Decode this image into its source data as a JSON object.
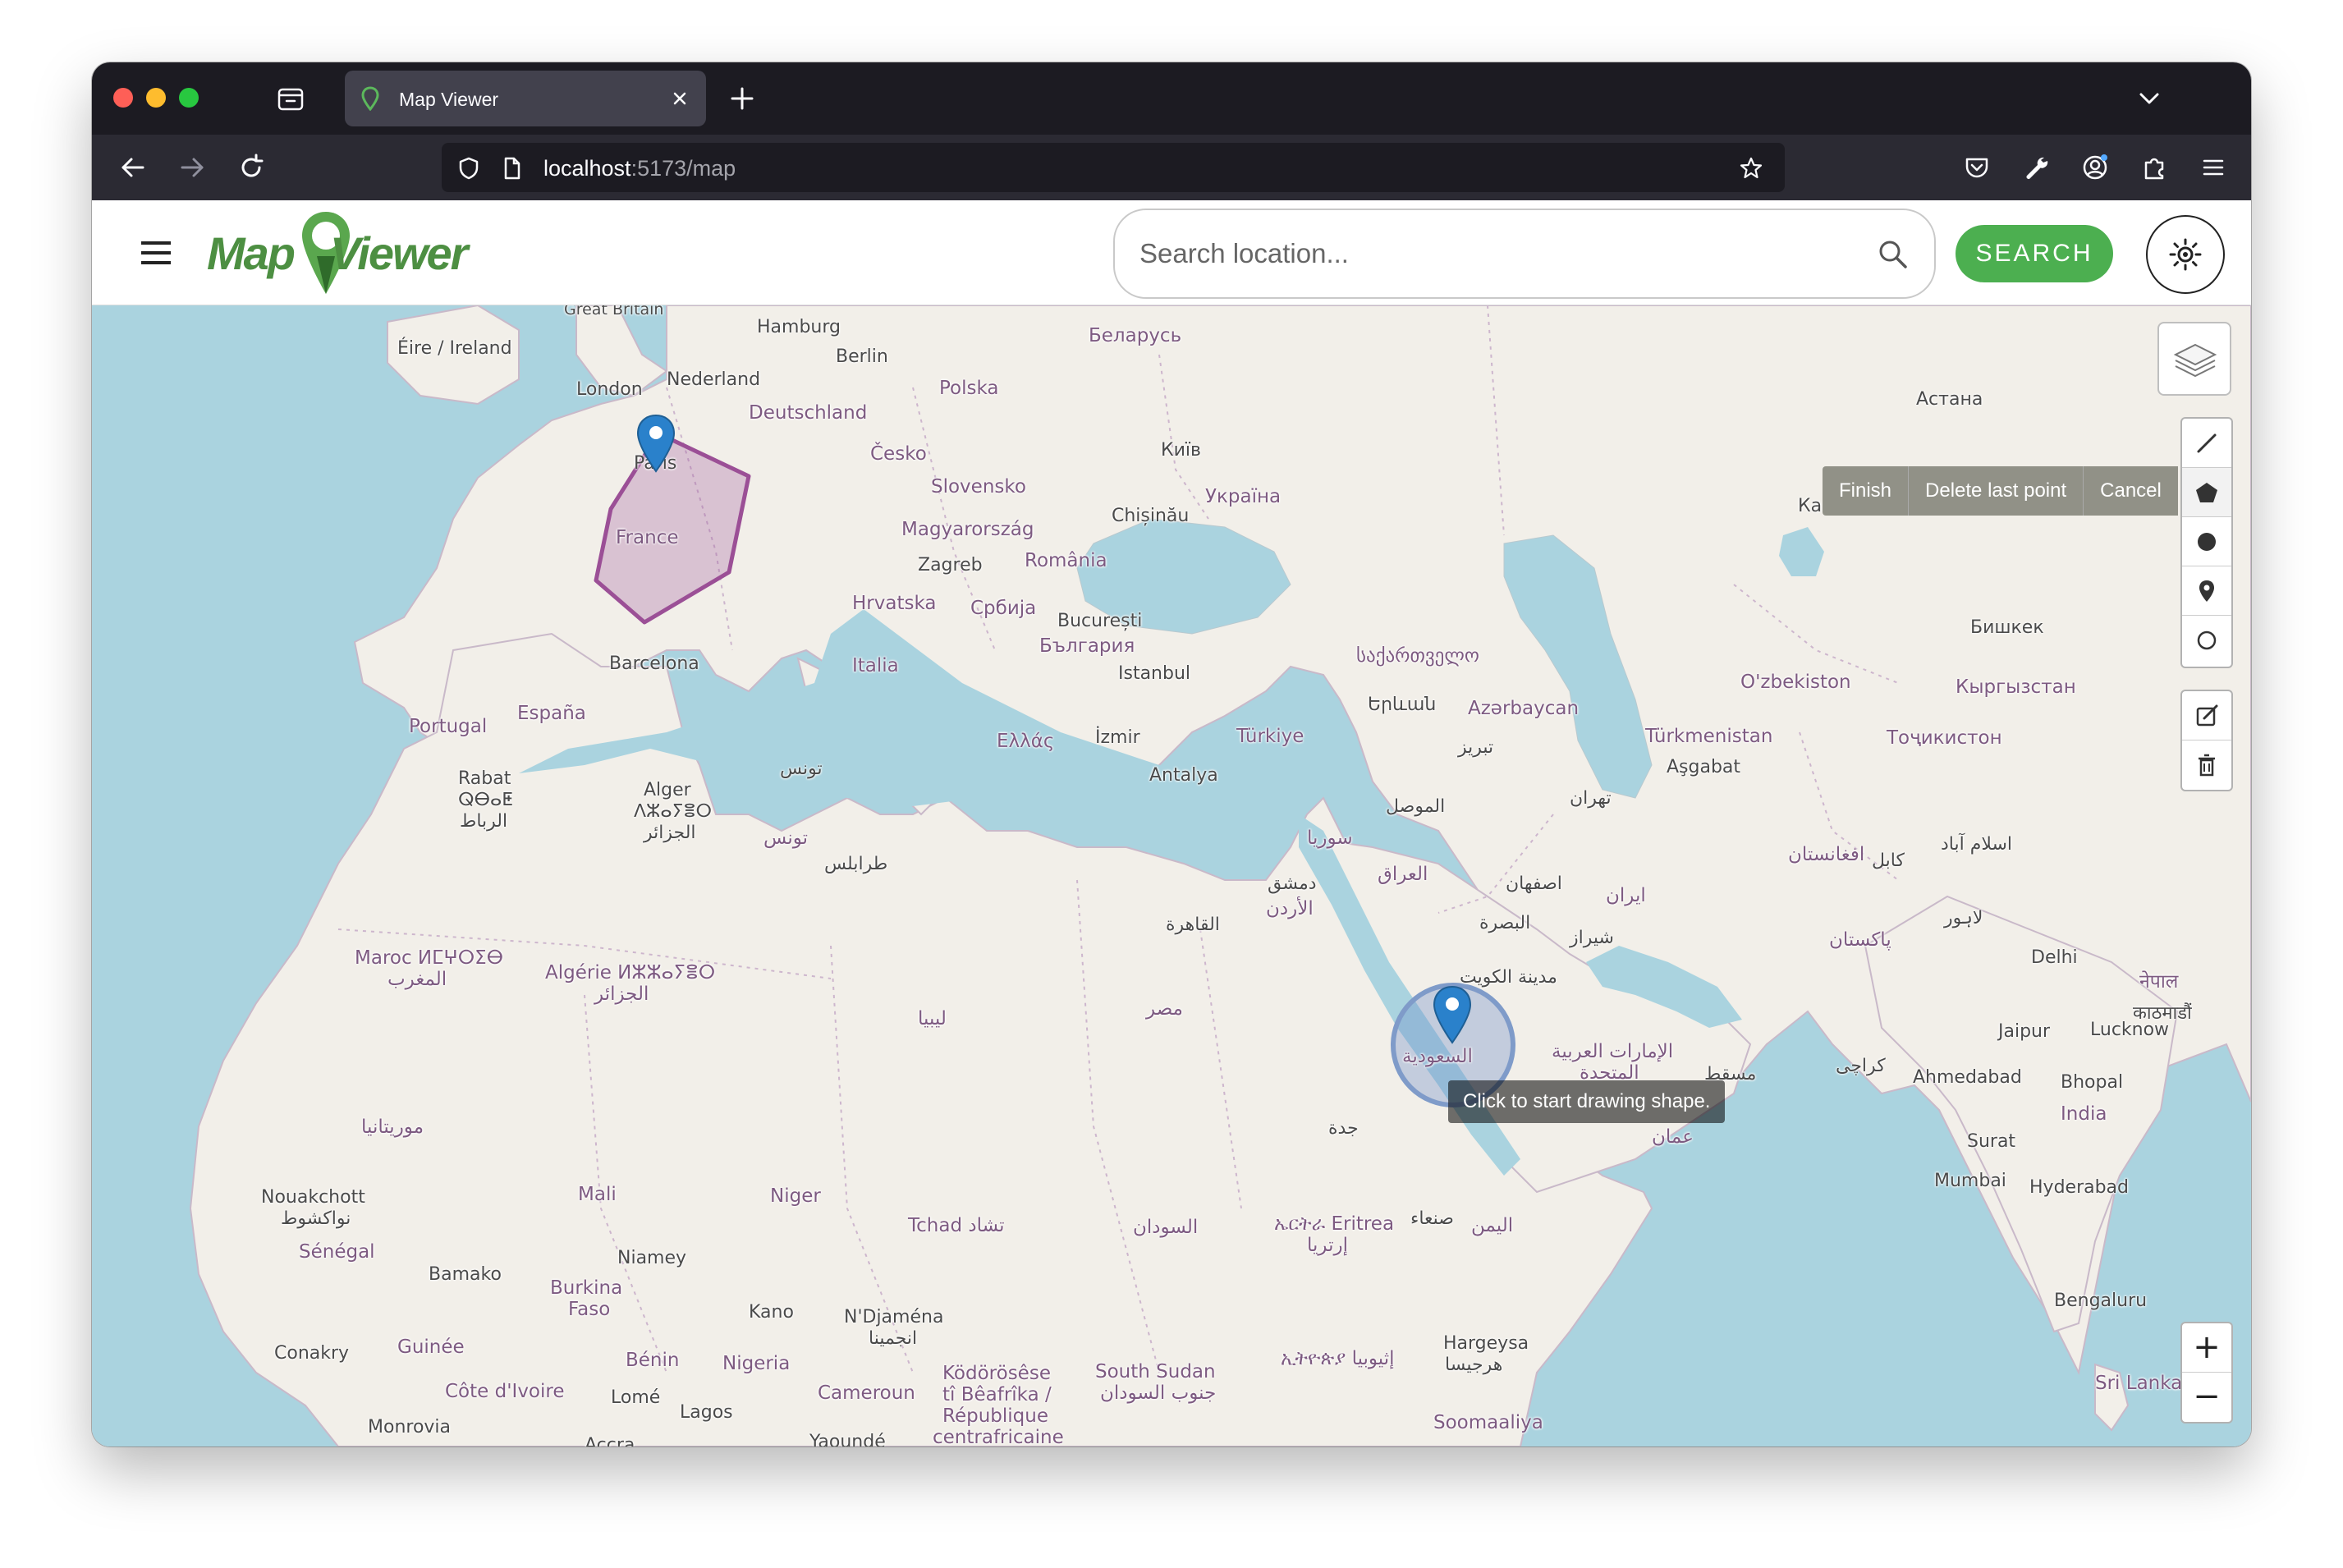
{
  "browser": {
    "tab_title": "Map Viewer",
    "url_host": "localhost",
    "url_path": ":5173/map"
  },
  "header": {
    "logo_left": "Map",
    "logo_right": "Viewer",
    "search_placeholder": "Search location...",
    "search_button": "SEARCH"
  },
  "map": {
    "draw_actions": [
      "Finish",
      "Delete last point",
      "Cancel"
    ],
    "tooltip": "Click to start drawing shape.",
    "zoom_in": "+",
    "zoom_out": "−",
    "labels": {
      "great_britain": "Great Britain",
      "eire": "Éire / Ireland",
      "london": "London",
      "nederland": "Nederland",
      "hamburg": "Hamburg",
      "berlin": "Berlin",
      "deutschland": "Deutschland",
      "polska": "Polska",
      "belarus": "Беларусь",
      "astana": "Астана",
      "paris": "Paris",
      "france": "France",
      "cesko": "Česko",
      "kyiv": "Київ",
      "slovensko": "Slovensko",
      "ukraina": "Україна",
      "magyarorszag": "Magyarország",
      "chisinau": "Chișinău",
      "zagreb": "Zagreb",
      "romania": "România",
      "hrvatska": "Hrvatska",
      "srbija": "Србија",
      "bucuresti": "București",
      "bulgaria": "България",
      "barcelona": "Barcelona",
      "italia": "Italia",
      "istanbul": "Istanbul",
      "sakartvelo": "საქართველო",
      "bishkek": "Бишкек",
      "uzbekiston": "O'zbekiston",
      "kyrgyzstan": "Кыргызстан",
      "portugal": "Portugal",
      "espana": "España",
      "yerevan": "Երևան",
      "azerbaycan": "Azərbaycan",
      "ellas": "Ελλάς",
      "izmir": "İzmir",
      "turkiye": "Türkiye",
      "turkmenistan": "Türkmenistan",
      "tojikiston": "Тоҷикистон",
      "tabriz": "تبریز",
      "ashgabat": "Aşgabat",
      "antalya": "Antalya",
      "rabat": "Rabat",
      "rabat_tif": "ⵕⴱⴰⵟ",
      "rabat_ar": "الرباط",
      "alger": "Alger",
      "alger_tif": "ⴷⵣⴰⵢⴻⵔ",
      "alger_ar": "الجزائر",
      "tunis": "تونس",
      "tunis2": "تونس",
      "tehran": "تهران",
      "mosul": "الموصل",
      "syria": "سوريا",
      "iraq": "العراق",
      "isfahan": "اصفهان",
      "iran": "ایران",
      "afghanistan": "افغانستان",
      "kabul": "کابل",
      "islamabad": "اسلام آباد",
      "tripoli": "طرابلس",
      "damascus": "دمشق",
      "jordan": "الأردن",
      "basra": "البصرة",
      "shiraz": "شيراز",
      "pakistan": "پاکستان",
      "lahore": "لاہور",
      "cairo": "القاهرة",
      "kuwait": "مدينة الكويت",
      "delhi": "Delhi",
      "nepal": "नेपाल",
      "kathmandu": "काठमाडौं",
      "maroc": "Maroc ⵍⵎⵖⵔⵉⴱ",
      "maroc_ar": "المغرب",
      "algerie": "Algérie ⵍⵣⵣⴰⵢⴻⵔ",
      "algerie_ar": "الجزائر",
      "libya": "ليبيا",
      "egypt": "مصر",
      "saudi": "السعودية",
      "uae": "الإمارات العربية",
      "uae2": "المتحدة",
      "muscat": "مسقط",
      "jaipur": "Jaipur",
      "lucknow": "Lucknow",
      "karachi": "کراچی",
      "ahmedabad": "Ahmedabad",
      "bhopal": "Bhopal",
      "india": "India",
      "oman": "عمان",
      "mauritania": "موريتانيا",
      "jeddah": "جدة",
      "surat": "Surat",
      "nouakchott": "Nouakchott",
      "nouakchott_ar": "نواكشوط",
      "mali": "Mali",
      "niger": "Niger",
      "mumbai": "Mumbai",
      "hyderabad": "Hyderabad",
      "senegal": "Sénégal",
      "tchad": "Tchad تشاد",
      "sudan": "السودان",
      "eritrea": "ኤርትራ Eritrea",
      "eritrea_ar": "إرتريا",
      "sanaa": "صنعاء",
      "yemen": "اليمن",
      "bamako": "Bamako",
      "niamey": "Niamey",
      "burkina": "Burkina",
      "faso": "Faso",
      "kano": "Kano",
      "ndjamena": "N'Djaména",
      "ndjamena_ar": "انجمينا",
      "bengaluru": "Bengaluru",
      "conakry": "Conakry",
      "guinee": "Guinée",
      "benin": "Bénin",
      "nigeria": "Nigeria",
      "kodorosese": "Ködörösêse",
      "beafrika": "tî Bêafrîka /",
      "republique": "République",
      "centrafricaine": "centrafricaine",
      "south_sudan": "South Sudan",
      "south_sudan_ar": "جنوب السودان",
      "ethiopia": "ኢትዮጵያ إثيوبيا",
      "hargeysa": "Hargeysa",
      "hargeysa_ar": "هرجيسا",
      "cote": "Côte d'Ivoire",
      "lome": "Lomé",
      "lagos": "Lagos",
      "cameroun": "Cameroun",
      "yaounde": "Yaoundé",
      "accra": "Accra",
      "monrovia": "Monrovia",
      "somaliya": "Soomaaliya",
      "srilanka": "Sri Lanka",
      "kazakh_partial": "Ка"
    }
  },
  "colors": {
    "accent_green": "#4caf50",
    "logo_green": "#4d8f42",
    "polygon": "#9b4f96",
    "marker": "#2a81cb",
    "water": "#aad3df",
    "land": "#f2efe9"
  }
}
